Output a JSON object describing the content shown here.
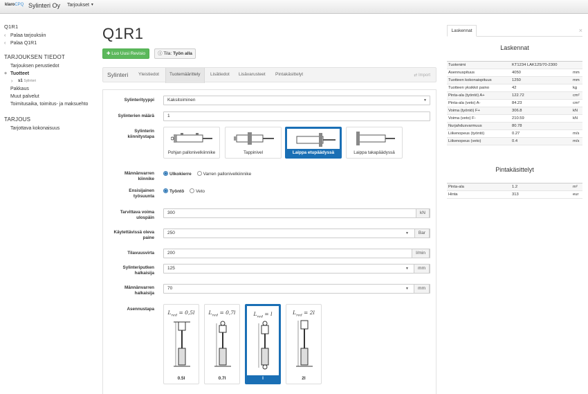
{
  "navbar": {
    "brand_a": "klaro",
    "brand_b": "CPQ",
    "company": "Sylinteri Oy",
    "menu": "Tarjoukset"
  },
  "sidebar": {
    "q_code": "Q1R1",
    "back_offers": "Palaa tarjouksiin",
    "back_q": "Palaa Q1R1",
    "section_info": "TARJOUKSEN TIEDOT",
    "basic_info": "Tarjouksen perustiedot",
    "products": "Tuotteet",
    "s1_code": "s1",
    "s1_name": "Sylinteri",
    "packing": "Pakkaus",
    "other_services": "Muut palvelut",
    "delivery": "Toimitusaika, toimitus- ja maksuehto",
    "section_offer": "TARJOUS",
    "total": "Tarjottava kokonaisuus"
  },
  "main": {
    "title": "Q1R1",
    "new_revision": "Luo Uusi Revisio",
    "status_prefix": "Tila:",
    "status_value": "Työn alla",
    "tab_label": "Sylinteri",
    "tabs": [
      "Yleistiedot",
      "Tuotemäärittely",
      "Lisätiedot",
      "Lisävarusteet",
      "Pintakäsittelyt"
    ],
    "import": "Import"
  },
  "form": {
    "type_label": "Sylinterityyppi",
    "type_value": "Kaksitoiminen",
    "qty_label": "Sylinterien määrä",
    "qty_value": "1",
    "mount_label": "Sylinterin kiinnitystapa",
    "mounts": [
      "Pohjan pallonivelkiinnike",
      "Tappinivel",
      "Laippa etupäädyssä",
      "Laippa takapäädyssä"
    ],
    "rod_label": "Männänvarren kiinnike",
    "rod_opt1": "Ulkokierre",
    "rod_opt2": "Varren pallonivelkiinnike",
    "dir_label": "Ensisijainen työsuunta",
    "dir_opt1": "Työntö",
    "dir_opt2": "Veto",
    "force_label": "Tarvittava voima ulospäin",
    "force_value": "300",
    "force_unit": "kN",
    "pressure_label": "Käytettävissä oleva paine",
    "pressure_value": "250",
    "pressure_unit": "Bar",
    "flow_label": "Tilavuusvirta",
    "flow_value": "200",
    "flow_unit": "l/min",
    "bore_label": "Sylinteriputken halkaisija",
    "bore_value": "125",
    "bore_unit": "mm",
    "rod_d_label": "Männänvarren halkaisija",
    "rod_d_value": "70",
    "rod_d_unit": "mm",
    "install_label": "Asennustapa",
    "install": [
      {
        "pre": "L",
        "sub": "red",
        "post": " = 0,5l",
        "cap": "0.5l"
      },
      {
        "pre": "L",
        "sub": "red",
        "post": " = 0,7l",
        "cap": "0.7l"
      },
      {
        "pre": "L",
        "sub": "red",
        "post": " = l",
        "cap": "l"
      },
      {
        "pre": "L",
        "sub": "red",
        "post": " = 2l",
        "cap": "2l"
      }
    ]
  },
  "right": {
    "tab": "Laskennat",
    "close": "×",
    "calc_title": "Laskennat",
    "calc_rows": [
      [
        "Tuotenimi",
        "KT1234 LAK125/70-2300",
        ""
      ],
      [
        "Asennuspituus",
        "4050",
        "mm"
      ],
      [
        "Tuotteen kokonaispituus",
        "1250",
        "mm"
      ],
      [
        "Tuotteen yksikkö paino",
        "42",
        "kg"
      ],
      [
        "Pinta-ala (työntö) A+",
        "122.72",
        "cm²"
      ],
      [
        "Pinta-ala (veto) A-",
        "84.23",
        "cm²"
      ],
      [
        "Voima (työntö) F+",
        "306.8",
        "kN"
      ],
      [
        "Voima (veto) F-",
        "210.59",
        "kN"
      ],
      [
        "Nurjahdusvarmuus",
        "80.78",
        ""
      ],
      [
        "Liikenopeus (työntö)",
        "0.27",
        "m/s"
      ],
      [
        "Liikenopeus (veto)",
        "0.4",
        "m/s"
      ]
    ],
    "surf_title": "Pintakäsittelyt",
    "surf_rows": [
      [
        "Pinta-ala",
        "1.2",
        "m²"
      ],
      [
        "Hinta",
        "313",
        "eur"
      ]
    ]
  },
  "colors": {
    "primary": "#1a6fb5",
    "success": "#5cb85c"
  }
}
